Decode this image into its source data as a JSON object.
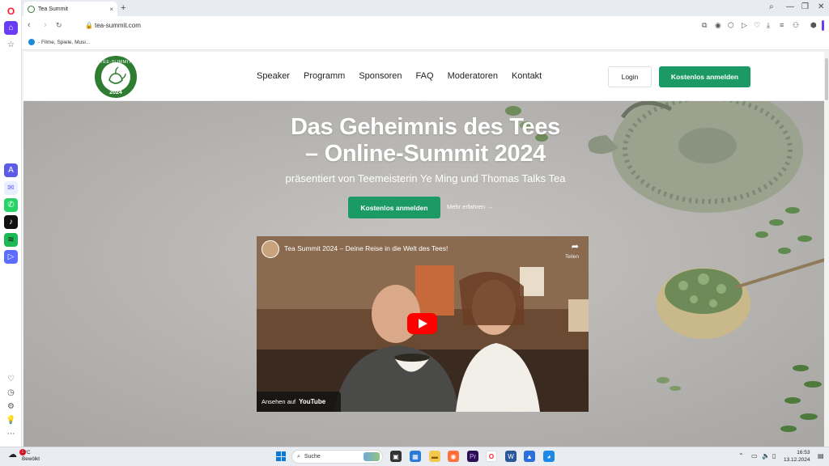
{
  "browser": {
    "tab_title": "Tea Summit",
    "tab_close": "×",
    "new_tab": "+",
    "url": "tea-summit.com",
    "bookmark": "- Filme, Spiele, Musi..."
  },
  "site": {
    "logo_text": "TEE-SUMMIT",
    "logo_year": "2024",
    "nav": [
      "Speaker",
      "Programm",
      "Sponsoren",
      "FAQ",
      "Moderatoren",
      "Kontakt"
    ],
    "login": "Login",
    "cta": "Kostenlos anmelden"
  },
  "hero": {
    "title_line1": "Das Geheimnis des Tees",
    "title_line2": "– Online-Summit 2024",
    "subtitle": "präsentiert von Teemeisterin Ye Ming und Thomas Talks Tea",
    "cta": "Kostenlos anmelden",
    "more": "Mehr erfahren →"
  },
  "video": {
    "title": "Tea Summit 2024 – Deine Reise in die Welt des Tees!",
    "share_label": "Teilen",
    "watch_on": "Ansehen auf",
    "youtube": "YouTube"
  },
  "taskbar": {
    "temp": "2°C",
    "weather": "Bewölkt",
    "weather_badge": "1",
    "search": "Suche",
    "time": "16:53",
    "date": "13.12.2024"
  },
  "colors": {
    "brand_green": "#1b9a65",
    "logo_green": "#2f7d32",
    "opera_red": "#ff1b2d",
    "youtube_red": "#ff0000"
  }
}
